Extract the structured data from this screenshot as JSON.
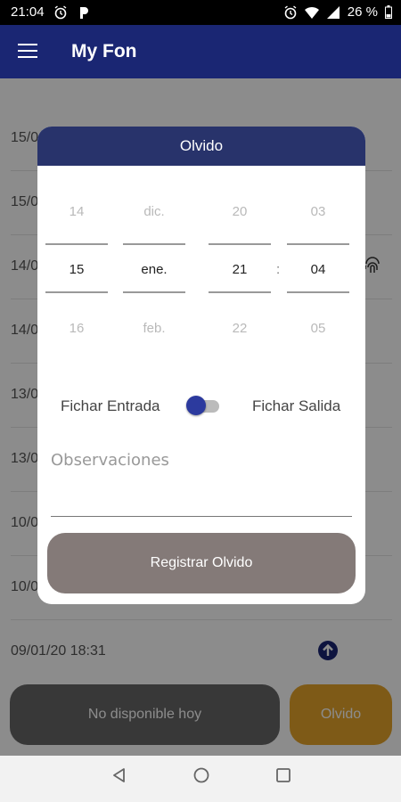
{
  "status_bar": {
    "time": "21:04",
    "battery": "26 %"
  },
  "app": {
    "title": "My Fon"
  },
  "list": {
    "rows": [
      "15/0",
      "15/0",
      "14/0",
      "14/0",
      "13/0",
      "13/0",
      "10/0",
      "10/0",
      "09/01/20 18:31"
    ]
  },
  "bottom": {
    "no_disponible": "No disponible hoy",
    "olvido": "Olvido"
  },
  "dialog": {
    "title": "Olvido",
    "picker": {
      "day": {
        "prev": "14",
        "sel": "15",
        "next": "16"
      },
      "month": {
        "prev": "dic.",
        "sel": "ene.",
        "next": "feb."
      },
      "hour": {
        "prev": "20",
        "sel": "21",
        "next": "22"
      },
      "minute": {
        "prev": "03",
        "sel": "04",
        "next": "05"
      },
      "separator": ":"
    },
    "toggle": {
      "left_label": "Fichar Entrada",
      "right_label": "Fichar Salida"
    },
    "observaciones_placeholder": "Observaciones",
    "submit_label": "Registrar Olvido"
  },
  "colors": {
    "appbar": "#1a2673",
    "dialog_header": "#28336b",
    "accent_orange": "#e6a52a",
    "toggle_knob": "#2c3a9e"
  }
}
